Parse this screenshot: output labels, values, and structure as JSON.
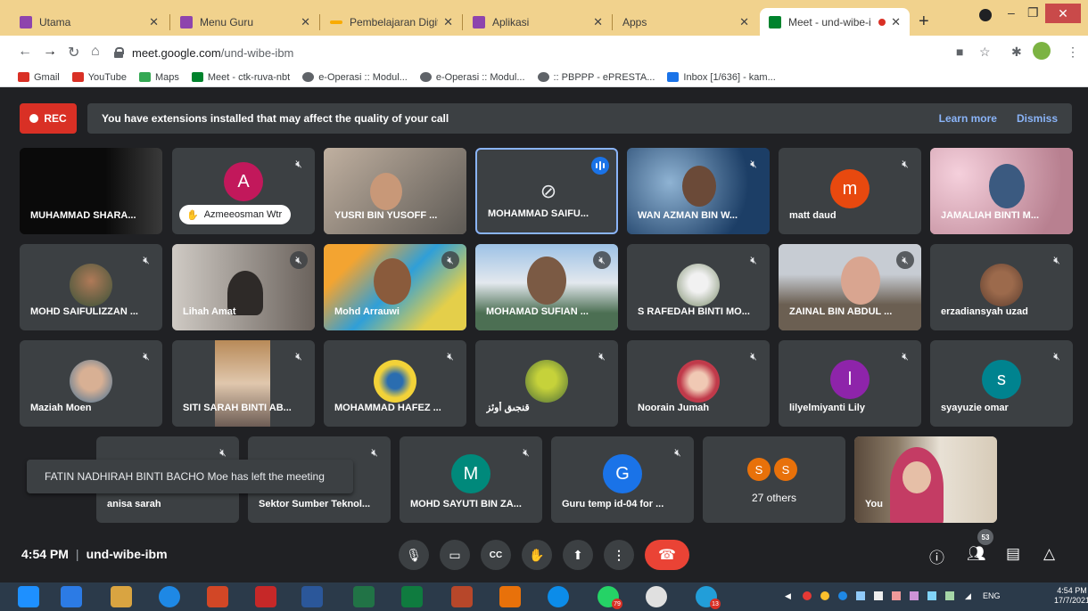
{
  "browser": {
    "tabs": [
      {
        "title": "Utama",
        "color": "#8e44ad"
      },
      {
        "title": "Menu Guru",
        "color": "#8e44ad"
      },
      {
        "title": "Pembelajaran Digital",
        "color": "#f9ab00"
      },
      {
        "title": "Aplikasi",
        "color": "#8e44ad"
      },
      {
        "title": "Apps",
        "color": ""
      },
      {
        "title": "Meet - und-wibe-i",
        "color": "#00832d"
      }
    ],
    "url_host": "meet.google.com",
    "url_path": "/und-wibe-ibm",
    "bookmarks": [
      {
        "label": "Gmail",
        "color": "#d93025"
      },
      {
        "label": "YouTube",
        "color": "#d93025"
      },
      {
        "label": "Maps",
        "color": "#34a853"
      },
      {
        "label": "Meet - ctk-ruva-nbt",
        "color": "#00832d"
      },
      {
        "label": "e-Operasi :: Modul...",
        "color": "#5f6368"
      },
      {
        "label": "e-Operasi :: Modul...",
        "color": "#5f6368"
      },
      {
        "label": ":: PBPPP - ePRESTA...",
        "color": "#5f6368"
      },
      {
        "label": "Inbox [1/636] - kam...",
        "color": "#1a73e8"
      }
    ]
  },
  "meet": {
    "rec_label": "REC",
    "banner": {
      "message": "You have extensions installed that may affect the quality of your call",
      "learn_more": "Learn more",
      "dismiss": "Dismiss"
    },
    "speaking": "Azmeeosman Wtr",
    "tiles": [
      {
        "name": "MUHAMMAD SHARA..."
      },
      {
        "name": "",
        "initial": "A",
        "color": "#c2185b"
      },
      {
        "name": "YUSRI BIN YUSOFF ..."
      },
      {
        "name": "MOHAMMAD SAIFU..."
      },
      {
        "name": "WAN AZMAN BIN W..."
      },
      {
        "name": "matt daud",
        "initial": "m",
        "color": "#e8490f"
      },
      {
        "name": "JAMALIAH BINTI M..."
      },
      {
        "name": "MOHD SAIFULIZZAN ..."
      },
      {
        "name": "Lihah Amat"
      },
      {
        "name": "Mohd Arrauwi"
      },
      {
        "name": "MOHAMAD SUFIAN ..."
      },
      {
        "name": "S RAFEDAH BINTI MO..."
      },
      {
        "name": "ZAINAL BIN ABDUL ..."
      },
      {
        "name": "erzadiansyah uzad"
      },
      {
        "name": "Maziah Moen"
      },
      {
        "name": "SITI SARAH BINTI AB..."
      },
      {
        "name": "MOHAMMAD HAFEZ ..."
      },
      {
        "name": "قنجىق أوئز"
      },
      {
        "name": "Noorain Jumah"
      },
      {
        "name": "lilyelmiyanti Lily",
        "initial": "l",
        "color": "#8e24aa"
      },
      {
        "name": "syayuzie omar",
        "initial": "s",
        "color": "#00838f"
      },
      {
        "name": "anisa sarah"
      },
      {
        "name": "Sektor Sumber Teknol..."
      },
      {
        "name": "MOHD SAYUTI BIN ZA...",
        "initial": "M",
        "color": "#00897b"
      },
      {
        "name": "Guru temp id-04 for ...",
        "initial": "G",
        "color": "#1a73e8"
      },
      {
        "name": "You"
      }
    ],
    "others": {
      "initials": [
        "S",
        "S"
      ],
      "count_label": "27 others"
    },
    "toast": "FATIN NADHIRAH BINTI BACHO Moe has left the meeting",
    "time": "4:54 PM",
    "meeting_code": "und-wibe-ibm",
    "participants_count": "53"
  },
  "taskbar": {
    "lang": "ENG",
    "time": "4:54 PM",
    "date": "17/7/2021",
    "whatsapp_badge": "79",
    "telegram_badge": "13"
  }
}
